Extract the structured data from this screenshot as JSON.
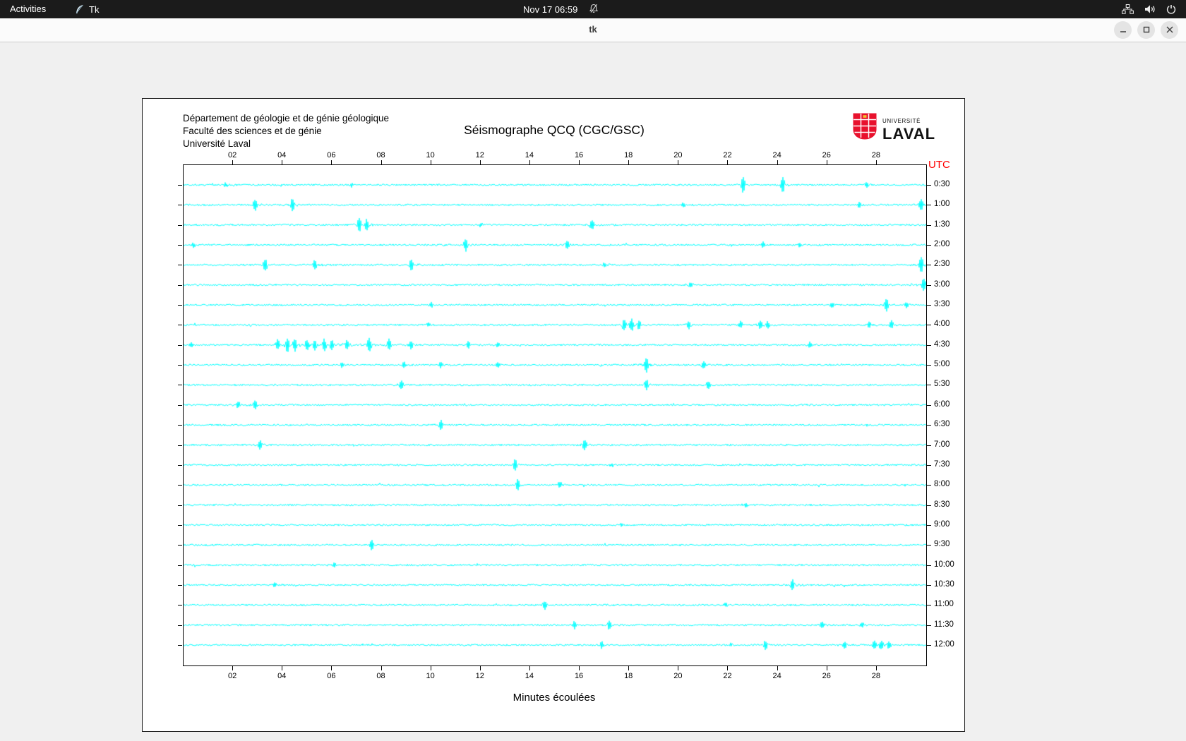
{
  "topbar": {
    "activities_label": "Activities",
    "app_name": "Tk",
    "clock": "Nov 17 06:59"
  },
  "window": {
    "title": "tk"
  },
  "seismograph": {
    "institution_lines": [
      "Département de géologie et de génie géologique",
      "Faculté des sciences et de génie",
      "Université Laval"
    ],
    "title": "Séismographe QCQ (CGC/GSC)",
    "logo_line1": "UNIVERSITÉ",
    "logo_line2": "LAVAL",
    "utc_label": "UTC",
    "xlabel": "Minutes écoulées"
  },
  "chart_data": {
    "type": "line",
    "title": "Séismographe QCQ (CGC/GSC)",
    "xlabel": "Minutes écoulées",
    "right_axis_label": "UTC",
    "x_range": [
      0,
      30
    ],
    "x_ticks": [
      "02",
      "04",
      "06",
      "08",
      "10",
      "12",
      "14",
      "16",
      "18",
      "20",
      "22",
      "24",
      "26",
      "28"
    ],
    "trace_color": "#00ffff",
    "axis_color": "#000000",
    "row_duration_minutes": 30,
    "spike_units": {
      "m": "minutes along row",
      "a": "approx peak amplitude in px"
    },
    "rows": [
      {
        "label": "0:30",
        "spikes": [
          {
            "m": 1.7,
            "a": 3
          },
          {
            "m": 6.8,
            "a": 3
          },
          {
            "m": 22.6,
            "a": 11
          },
          {
            "m": 24.2,
            "a": 12
          },
          {
            "m": 27.6,
            "a": 4
          }
        ]
      },
      {
        "label": "1:00",
        "spikes": [
          {
            "m": 2.9,
            "a": 9
          },
          {
            "m": 4.4,
            "a": 10
          },
          {
            "m": 20.2,
            "a": 3
          },
          {
            "m": 27.3,
            "a": 4
          },
          {
            "m": 29.8,
            "a": 8
          }
        ]
      },
      {
        "label": "1:30",
        "spikes": [
          {
            "m": 7.1,
            "a": 10
          },
          {
            "m": 7.4,
            "a": 8
          },
          {
            "m": 12.0,
            "a": 3
          },
          {
            "m": 16.5,
            "a": 7
          }
        ]
      },
      {
        "label": "2:00",
        "spikes": [
          {
            "m": 0.4,
            "a": 3
          },
          {
            "m": 11.4,
            "a": 9
          },
          {
            "m": 15.5,
            "a": 5
          },
          {
            "m": 23.4,
            "a": 4
          },
          {
            "m": 24.9,
            "a": 3
          }
        ]
      },
      {
        "label": "2:30",
        "spikes": [
          {
            "m": 3.3,
            "a": 9
          },
          {
            "m": 5.3,
            "a": 7
          },
          {
            "m": 9.2,
            "a": 8
          },
          {
            "m": 17.0,
            "a": 3
          },
          {
            "m": 29.8,
            "a": 12
          }
        ]
      },
      {
        "label": "3:00",
        "spikes": [
          {
            "m": 20.5,
            "a": 4
          },
          {
            "m": 29.9,
            "a": 10
          }
        ]
      },
      {
        "label": "3:30",
        "spikes": [
          {
            "m": 10.0,
            "a": 4
          },
          {
            "m": 26.2,
            "a": 3
          },
          {
            "m": 28.4,
            "a": 9
          },
          {
            "m": 29.2,
            "a": 5
          }
        ]
      },
      {
        "label": "4:00",
        "spikes": [
          {
            "m": 9.9,
            "a": 3
          },
          {
            "m": 17.8,
            "a": 8
          },
          {
            "m": 18.1,
            "a": 9
          },
          {
            "m": 18.4,
            "a": 7
          },
          {
            "m": 20.4,
            "a": 6
          },
          {
            "m": 22.5,
            "a": 5
          },
          {
            "m": 23.3,
            "a": 6
          },
          {
            "m": 23.6,
            "a": 5
          },
          {
            "m": 27.7,
            "a": 4
          },
          {
            "m": 28.6,
            "a": 6
          }
        ]
      },
      {
        "label": "4:30",
        "spikes": [
          {
            "m": 0.3,
            "a": 4
          },
          {
            "m": 3.8,
            "a": 8
          },
          {
            "m": 4.2,
            "a": 10
          },
          {
            "m": 4.5,
            "a": 9
          },
          {
            "m": 5.0,
            "a": 8
          },
          {
            "m": 5.3,
            "a": 7
          },
          {
            "m": 5.7,
            "a": 9
          },
          {
            "m": 6.0,
            "a": 8
          },
          {
            "m": 6.6,
            "a": 7
          },
          {
            "m": 7.5,
            "a": 10
          },
          {
            "m": 8.3,
            "a": 8
          },
          {
            "m": 9.2,
            "a": 6
          },
          {
            "m": 11.5,
            "a": 5
          },
          {
            "m": 12.7,
            "a": 4
          },
          {
            "m": 25.3,
            "a": 4
          }
        ]
      },
      {
        "label": "5:00",
        "spikes": [
          {
            "m": 6.4,
            "a": 4
          },
          {
            "m": 8.9,
            "a": 5
          },
          {
            "m": 10.4,
            "a": 4
          },
          {
            "m": 12.7,
            "a": 5
          },
          {
            "m": 18.7,
            "a": 11
          },
          {
            "m": 21.0,
            "a": 5
          }
        ]
      },
      {
        "label": "5:30",
        "spikes": [
          {
            "m": 8.8,
            "a": 7
          },
          {
            "m": 18.7,
            "a": 8
          },
          {
            "m": 21.2,
            "a": 6
          }
        ]
      },
      {
        "label": "6:00",
        "spikes": [
          {
            "m": 2.2,
            "a": 5
          },
          {
            "m": 2.9,
            "a": 7
          }
        ]
      },
      {
        "label": "6:30",
        "spikes": [
          {
            "m": 10.4,
            "a": 8
          }
        ]
      },
      {
        "label": "7:00",
        "spikes": [
          {
            "m": 3.1,
            "a": 7
          },
          {
            "m": 16.2,
            "a": 8
          }
        ]
      },
      {
        "label": "7:30",
        "spikes": [
          {
            "m": 13.4,
            "a": 9
          },
          {
            "m": 17.3,
            "a": 3
          }
        ]
      },
      {
        "label": "8:00",
        "spikes": [
          {
            "m": 13.5,
            "a": 8
          },
          {
            "m": 15.2,
            "a": 5
          }
        ]
      },
      {
        "label": "8:30",
        "spikes": [
          {
            "m": 22.7,
            "a": 3
          }
        ]
      },
      {
        "label": "9:00",
        "spikes": [
          {
            "m": 17.7,
            "a": 2
          }
        ]
      },
      {
        "label": "9:30",
        "spikes": [
          {
            "m": 7.6,
            "a": 8
          }
        ]
      },
      {
        "label": "10:00",
        "spikes": [
          {
            "m": 6.1,
            "a": 3
          }
        ]
      },
      {
        "label": "10:30",
        "spikes": [
          {
            "m": 3.7,
            "a": 3
          },
          {
            "m": 24.6,
            "a": 8
          }
        ]
      },
      {
        "label": "11:00",
        "spikes": [
          {
            "m": 14.6,
            "a": 6
          },
          {
            "m": 21.9,
            "a": 3
          }
        ]
      },
      {
        "label": "11:30",
        "spikes": [
          {
            "m": 15.8,
            "a": 6
          },
          {
            "m": 17.2,
            "a": 7
          },
          {
            "m": 25.8,
            "a": 4
          },
          {
            "m": 27.4,
            "a": 4
          }
        ]
      },
      {
        "label": "12:00",
        "spikes": [
          {
            "m": 16.9,
            "a": 5
          },
          {
            "m": 22.1,
            "a": 3
          },
          {
            "m": 23.5,
            "a": 7
          },
          {
            "m": 26.7,
            "a": 5
          },
          {
            "m": 27.9,
            "a": 6
          },
          {
            "m": 28.2,
            "a": 7
          },
          {
            "m": 28.5,
            "a": 5
          }
        ]
      }
    ]
  }
}
